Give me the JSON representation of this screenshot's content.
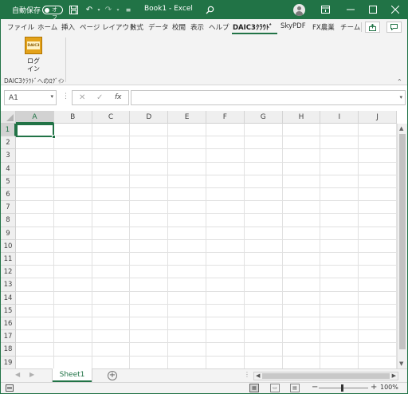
{
  "titlebar": {
    "autosave_label": "自動保存",
    "autosave_state": "オフ",
    "title": "Book1 - Excel",
    "save_icon": "save-icon",
    "undo_icon": "undo-icon",
    "redo_icon": "redo-icon",
    "search_icon": "search-icon",
    "colors": {
      "bg": "#217346",
      "fg": "#ffffff"
    }
  },
  "ribbon_tabs": [
    "ファイル",
    "ホーム",
    "挿入",
    "ページ レイアウト",
    "数式",
    "データ",
    "校閲",
    "表示",
    "ヘルプ",
    "DAIC3ｸﾗｳﾄﾞ",
    "SkyPDF",
    "FX農業",
    "チーム"
  ],
  "active_tab": "DAIC3ｸﾗｳﾄﾞ",
  "ribbon": {
    "login_icon_text": "DAIC3",
    "login_line1": "ログ",
    "login_line2": "イン",
    "group_label": "DAIC3ｸﾗｳﾄﾞへのﾛｸﾞｲﾝ"
  },
  "formula_bar": {
    "name_box": "A1",
    "cancel": "✕",
    "enter": "✓",
    "fx": "fx",
    "value": ""
  },
  "grid": {
    "columns": [
      "A",
      "B",
      "C",
      "D",
      "E",
      "F",
      "G",
      "H",
      "I",
      "J"
    ],
    "rows": [
      "1",
      "2",
      "3",
      "4",
      "5",
      "6",
      "7",
      "8",
      "9",
      "10",
      "11",
      "12",
      "13",
      "14",
      "15",
      "16",
      "17",
      "18",
      "19"
    ],
    "selected_cell": "A1"
  },
  "sheets": [
    "Sheet1"
  ],
  "active_sheet": "Sheet1",
  "status": {
    "zoom": "100%",
    "zoom_minus": "−",
    "zoom_plus": "+"
  }
}
